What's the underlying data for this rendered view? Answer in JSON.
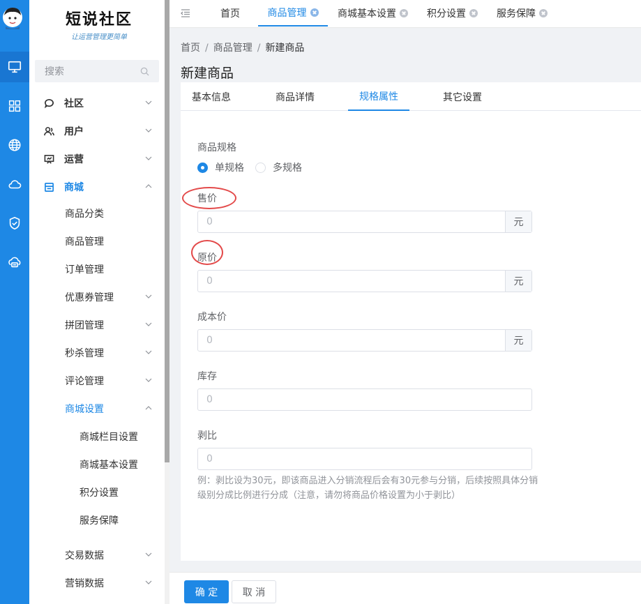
{
  "sidebar": {
    "logo_title": "短说社区",
    "logo_slogan": "让运营管理更简单",
    "search_placeholder": "搜索",
    "menu": {
      "community": "社区",
      "users": "用户",
      "operations": "运营",
      "mall": "商城",
      "category": "商品分类",
      "goods": "商品管理",
      "orders": "订单管理",
      "coupons": "优惠券管理",
      "groupbuy": "拼团管理",
      "flashsale": "秒杀管理",
      "reviews": "评论管理",
      "mall_settings": "商城设置",
      "column_settings": "商城栏目设置",
      "basic_settings": "商城基本设置",
      "points_settings": "积分设置",
      "service": "服务保障",
      "trade_data": "交易数据",
      "marketing_data": "营销数据"
    }
  },
  "tabs": {
    "home": "首页",
    "goods": "商品管理",
    "basic": "商城基本设置",
    "points": "积分设置",
    "service": "服务保障"
  },
  "breadcrumb": {
    "home": "首页",
    "goods": "商品管理",
    "current": "新建商品",
    "sep": "/"
  },
  "page_title": "新建商品",
  "subtabs": {
    "basic": "基本信息",
    "detail": "商品详情",
    "spec": "规格属性",
    "other": "其它设置"
  },
  "form": {
    "spec_label": "商品规格",
    "spec_single": "单规格",
    "spec_multi": "多规格",
    "price_label": "售价",
    "price_value": "0",
    "orig_label": "原价",
    "orig_value": "0",
    "cost_label": "成本价",
    "cost_value": "0",
    "stock_label": "库存",
    "stock_value": "0",
    "strip_label": "剥比",
    "strip_value": "0",
    "unit": "元",
    "hint": "例：剥比设为30元，即该商品进入分销流程后会有30元参与分销，后续按照具体分销级别分成比例进行分成（注意，请勿将商品价格设置为小于剥比）"
  },
  "footer": {
    "confirm": "确 定",
    "cancel": "取 消"
  },
  "colors": {
    "accent": "#1e88e5",
    "annotation": "#e34a4a"
  }
}
